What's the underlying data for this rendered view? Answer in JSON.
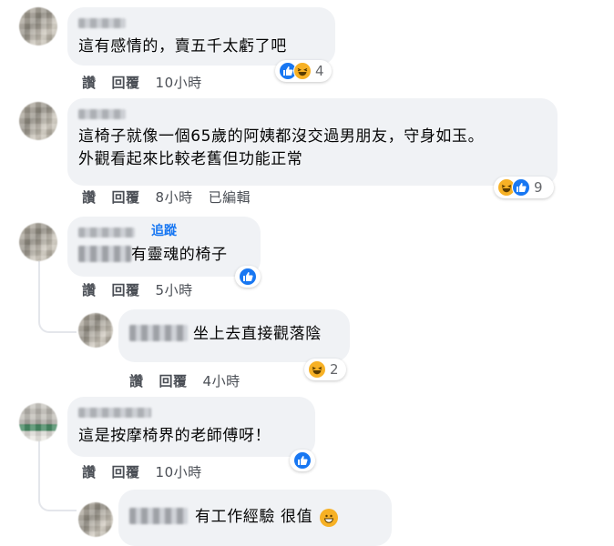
{
  "actions": {
    "like": "讚",
    "reply": "回覆"
  },
  "comments": [
    {
      "text": "這有感情的，賣五千太虧了吧",
      "time": "10小時",
      "react_count": "4"
    },
    {
      "text_line1": "這椅子就像一個65歲的阿姨都沒交過男朋友，守身如玉。",
      "text_line2": "外觀看起來比較老舊但功能正常",
      "time": "8小時",
      "edited": "已編輯",
      "react_count": "9"
    },
    {
      "follow": "追蹤",
      "prefix": "...",
      "text": "有靈魂的椅子",
      "time": "5小時"
    },
    {
      "text": "坐上去直接觀落陰",
      "time": "4小時",
      "react_count": "2"
    },
    {
      "text": "這是按摩椅界的老師傅呀！",
      "time": "10小時"
    },
    {
      "text": "有工作經驗 很值"
    }
  ],
  "colors": {
    "like_blue": "#1877f2",
    "haha_yellow": "#f7b125",
    "bubble_bg": "#f0f2f5"
  }
}
